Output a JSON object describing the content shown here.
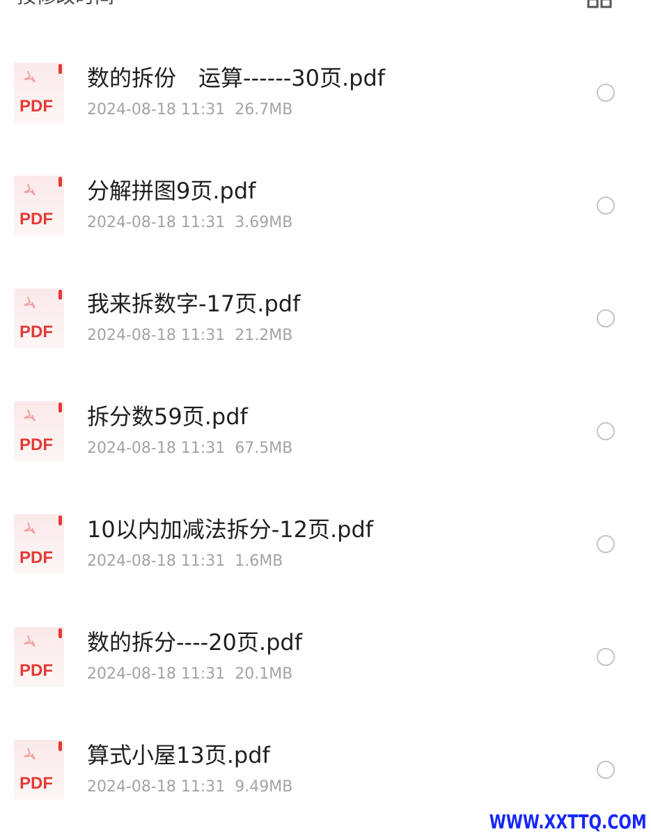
{
  "sort_bar": {
    "label": "按修改时间",
    "caret_icon": "caret-down-icon",
    "view_toggle_icon": "grid-view-icon"
  },
  "files": [
    {
      "name": "数的拆份　运算------30页.pdf",
      "date": "2024-08-18 11:31",
      "size": "26.7MB",
      "icon": "pdf-file-icon"
    },
    {
      "name": "分解拼图9页.pdf",
      "date": "2024-08-18 11:31",
      "size": "3.69MB",
      "icon": "pdf-file-icon"
    },
    {
      "name": "我来拆数字-17页.pdf",
      "date": "2024-08-18 11:31",
      "size": "21.2MB",
      "icon": "pdf-file-icon"
    },
    {
      "name": "拆分数59页.pdf",
      "date": "2024-08-18 11:31",
      "size": "67.5MB",
      "icon": "pdf-file-icon"
    },
    {
      "name": "10以内加减法拆分-12页.pdf",
      "date": "2024-08-18 11:31",
      "size": "1.6MB",
      "icon": "pdf-file-icon"
    },
    {
      "name": "数的拆分----20页.pdf",
      "date": "2024-08-18 11:31",
      "size": "20.1MB",
      "icon": "pdf-file-icon"
    },
    {
      "name": "算式小屋13页.pdf",
      "date": "2024-08-18 11:31",
      "size": "9.49MB",
      "icon": "pdf-file-icon"
    }
  ],
  "pdf_icon_text": "PDF",
  "watermark": "WWW.XXTTQ.COM",
  "colors": {
    "pdf_red": "#e53935",
    "title_text": "#1f1f1f",
    "meta_text": "#a3a3a3",
    "watermark_blue": "#1726ff"
  }
}
